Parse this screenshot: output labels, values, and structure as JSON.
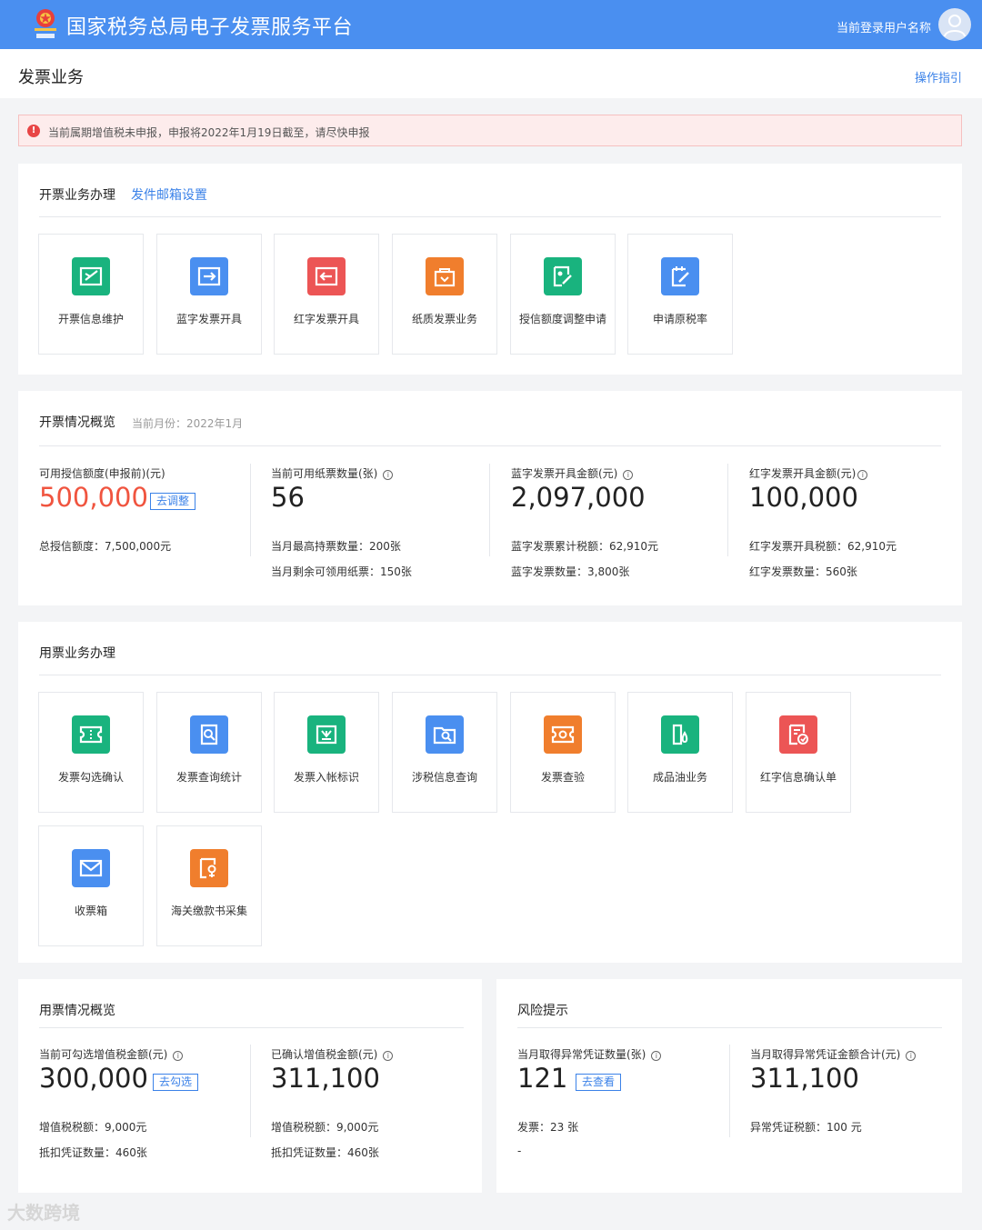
{
  "header": {
    "title": "国家税务总局电子发票服务平台",
    "logo_icon": "tax-emblem-icon",
    "user_name": "当前登录用户名称",
    "avatar_icon": "user-avatar-icon"
  },
  "subheader": {
    "page_title": "发票业务",
    "guide_link": "操作指引"
  },
  "alert": {
    "icon": "exclamation-icon",
    "text": "当前属期增值税未申报，申报将2022年1月19日截至，请尽快申报"
  },
  "issue_section": {
    "title": "开票业务办理",
    "link": "发件邮箱设置",
    "tiles": [
      {
        "label": "开票信息维护",
        "icon": "edit-invoice-icon",
        "color": "#19b37e"
      },
      {
        "label": "蓝字发票开具",
        "icon": "transfer-right-icon",
        "color": "#4a8ff0"
      },
      {
        "label": "红字发票开具",
        "icon": "transfer-left-icon",
        "color": "#ec5555"
      },
      {
        "label": "纸质发票业务",
        "icon": "paper-bag-icon",
        "color": "#f07e2d"
      },
      {
        "label": "授信额度调整申请",
        "icon": "credit-edit-icon",
        "color": "#19b37e"
      },
      {
        "label": "申请原税率",
        "icon": "notepad-edit-icon",
        "color": "#4a8ff0"
      }
    ]
  },
  "issue_overview": {
    "title": "开票情况概览",
    "subtitle": "当前月份：2022年1月",
    "stats": [
      {
        "label": "可用授信额度(申报前)(元)",
        "value": "500,000",
        "button": "去调整",
        "line1": "总授信额度：7,500,000元",
        "line2": ""
      },
      {
        "label": "当前可用纸票数量(张)",
        "value": "56",
        "line1": "当月最高持票数量：200张",
        "line2": "当月剩余可领用纸票：150张"
      },
      {
        "label": "蓝字发票开具金额(元)",
        "value": "2,097,000",
        "line1": "蓝字发票累计税额：62,910元",
        "line2": "蓝字发票数量：3,800张"
      },
      {
        "label": "红字发票开具金额(元)",
        "value": "100,000",
        "line1": "红字发票开具税额：62,910元",
        "line2": "红字发票数量：560张"
      }
    ]
  },
  "use_section": {
    "title": "用票业务办理",
    "tiles": [
      {
        "label": "发票勾选确认",
        "icon": "ticket-check-icon",
        "color": "#19b37e"
      },
      {
        "label": "发票查询统计",
        "icon": "document-search-icon",
        "color": "#4a8ff0"
      },
      {
        "label": "发票入帐标识",
        "icon": "download-tray-icon",
        "color": "#19b37e"
      },
      {
        "label": "涉税信息查询",
        "icon": "folder-search-icon",
        "color": "#4a8ff0"
      },
      {
        "label": "发票查验",
        "icon": "ticket-inspect-icon",
        "color": "#f07e2d"
      },
      {
        "label": "成品油业务",
        "icon": "oil-drop-icon",
        "color": "#19b37e"
      },
      {
        "label": "红字信息确认单",
        "icon": "form-check-icon",
        "color": "#ec5555"
      },
      {
        "label": "收票箱",
        "icon": "mail-icon",
        "color": "#4a8ff0"
      },
      {
        "label": "海关缴款书采集",
        "icon": "customs-document-icon",
        "color": "#f07e2d"
      }
    ]
  },
  "use_overview": {
    "title": "用票情况概览",
    "stats": [
      {
        "label": "当前可勾选增值税金额(元)",
        "value": "300,000",
        "button": "去勾选",
        "line1": "增值税税额：9,000元",
        "line2": "抵扣凭证数量：460张"
      },
      {
        "label": "已确认增值税金额(元)",
        "value": "311,100",
        "line1": "增值税税额：9,000元",
        "line2": "抵扣凭证数量：460张"
      }
    ]
  },
  "risk": {
    "title": "风险提示",
    "stats": [
      {
        "label": "当月取得异常凭证数量(张)",
        "value": "121",
        "button": "去查看",
        "line1": "发票：23 张",
        "line2": "-"
      },
      {
        "label": "当月取得异常凭证金额合计(元)",
        "value": "311,100",
        "line1": "异常凭证税额：100 元",
        "line2": ""
      }
    ]
  },
  "watermark": "大数跨境"
}
